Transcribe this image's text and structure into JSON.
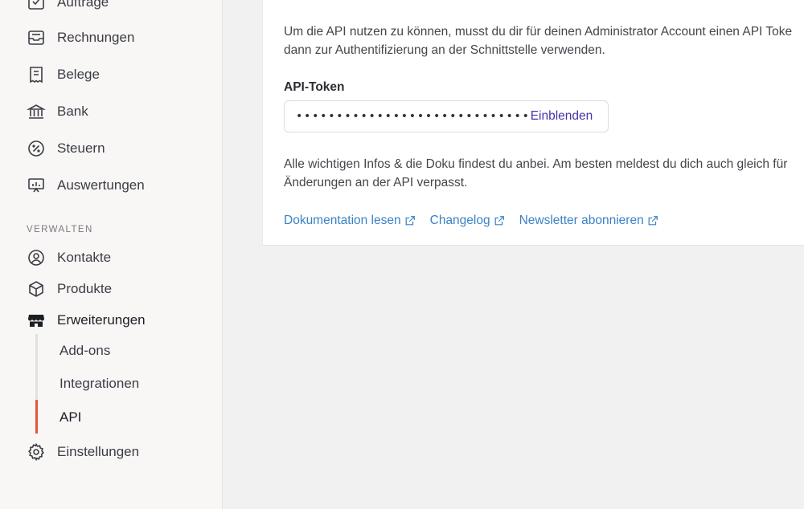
{
  "sidebar": {
    "items": [
      {
        "label": "Aufträge",
        "icon": "inbox-check-icon"
      },
      {
        "label": "Rechnungen",
        "icon": "inbox-icon"
      },
      {
        "label": "Belege",
        "icon": "receipt-icon"
      },
      {
        "label": "Bank",
        "icon": "bank-icon"
      },
      {
        "label": "Steuern",
        "icon": "percent-circle-icon"
      },
      {
        "label": "Auswertungen",
        "icon": "presentation-chart-icon"
      }
    ],
    "section_label": "VERWALTEN",
    "manage_items": [
      {
        "label": "Kontakte",
        "icon": "user-circle-icon"
      },
      {
        "label": "Produkte",
        "icon": "box-icon"
      },
      {
        "label": "Erweiterungen",
        "icon": "store-icon"
      }
    ],
    "sub_items": [
      {
        "label": "Add-ons"
      },
      {
        "label": "Integrationen"
      },
      {
        "label": "API"
      }
    ],
    "settings": {
      "label": "Einstellungen",
      "icon": "gear-icon"
    },
    "accent_color": "#e8553a"
  },
  "main": {
    "intro_line1": "Um die API nutzen zu können, musst du dir für deinen Administrator Account einen API Toke",
    "intro_line2": "dann zur Authentifizierung an der Schnittstelle verwenden.",
    "token_label": "API-Token",
    "token_masked": "•••••••••••••••••••••••••••••",
    "reveal_label": "Einblenden",
    "info_line1": "Alle wichtigen Infos & die Doku findest du anbei. Am besten meldest du dich auch gleich für",
    "info_line2": "Änderungen an der API verpasst.",
    "links": [
      {
        "label": "Dokumentation lesen",
        "icon": "external-link-icon"
      },
      {
        "label": "Changelog",
        "icon": "external-link-icon"
      },
      {
        "label": "Newsletter abonnieren",
        "icon": "external-link-icon"
      }
    ]
  }
}
